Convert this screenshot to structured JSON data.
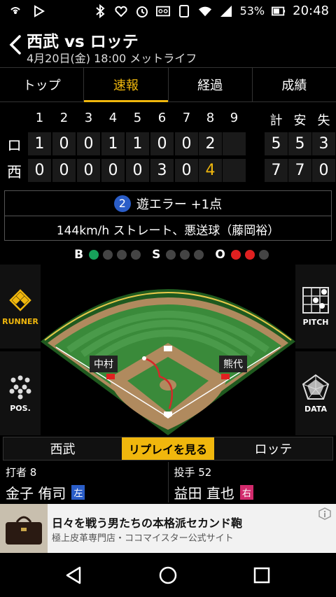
{
  "status_bar": {
    "battery": "53%",
    "time": "20:48"
  },
  "header": {
    "title": "西武 vs ロッテ",
    "subtitle": "4月20日(金) 18:00 メットライフ"
  },
  "tabs": [
    {
      "label": "トップ"
    },
    {
      "label": "速報"
    },
    {
      "label": "経過"
    },
    {
      "label": "成績"
    }
  ],
  "scoreboard": {
    "innings": [
      "1",
      "2",
      "3",
      "4",
      "5",
      "6",
      "7",
      "8",
      "9"
    ],
    "total_headers": [
      "計",
      "安",
      "失"
    ],
    "rows": [
      {
        "team": "ロ",
        "innings": [
          "1",
          "0",
          "0",
          "1",
          "1",
          "0",
          "0",
          "2",
          ""
        ],
        "totals": [
          "5",
          "5",
          "3"
        ]
      },
      {
        "team": "西",
        "innings": [
          "0",
          "0",
          "0",
          "0",
          "0",
          "3",
          "0",
          "4",
          ""
        ],
        "totals": [
          "7",
          "7",
          "0"
        ]
      }
    ]
  },
  "play": {
    "outs": "2",
    "result": "遊エラー +1点",
    "detail": "144km/h ストレート、悪送球（藤岡裕）"
  },
  "count": {
    "b_label": "B",
    "s_label": "S",
    "o_label": "O",
    "balls": 1,
    "strikes": 0,
    "outs": 2
  },
  "field": {
    "runner_left_name": "中村",
    "runner_right_name": "熊代"
  },
  "side_buttons": {
    "runner": "RUNNER",
    "pos": "POS.",
    "pitch": "PITCH",
    "data": "DATA"
  },
  "teambar": {
    "left_team": "西武",
    "replay": "リプレイを見る",
    "right_team": "ロッテ"
  },
  "batter": {
    "role": "打者 8",
    "name": "金子 侑司",
    "hand": "左"
  },
  "pitcher": {
    "role": "投手 52",
    "name": "益田 直也",
    "hand": "右"
  },
  "ad": {
    "title": "日々を戦う男たちの本格派セカンド鞄",
    "subtitle": "極上皮革専門店・ココマイスター公式サイト"
  },
  "colors": {
    "accent": "#f0b70d",
    "ball": "#17a05a",
    "out": "#e02020",
    "grass": "#3a8a3a",
    "dirt": "#b08a5e"
  }
}
